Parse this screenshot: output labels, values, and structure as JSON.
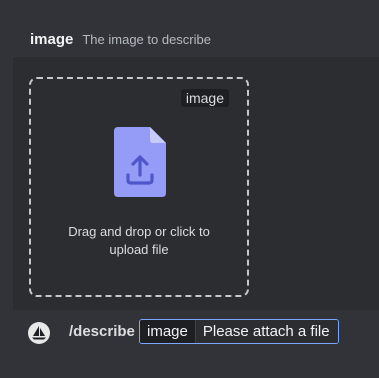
{
  "option": {
    "name": "image",
    "description": "The image to describe"
  },
  "dropzone": {
    "tag": "image",
    "text": "Drag and drop or click to upload file",
    "icon": "upload-file-icon"
  },
  "command": {
    "name": "/describe",
    "argument_name": "image",
    "argument_placeholder": "Please attach a file",
    "bot_icon": "sailboat-icon"
  },
  "colors": {
    "icon_accent": "#949cf7",
    "focus_border": "#7aa8ff"
  }
}
